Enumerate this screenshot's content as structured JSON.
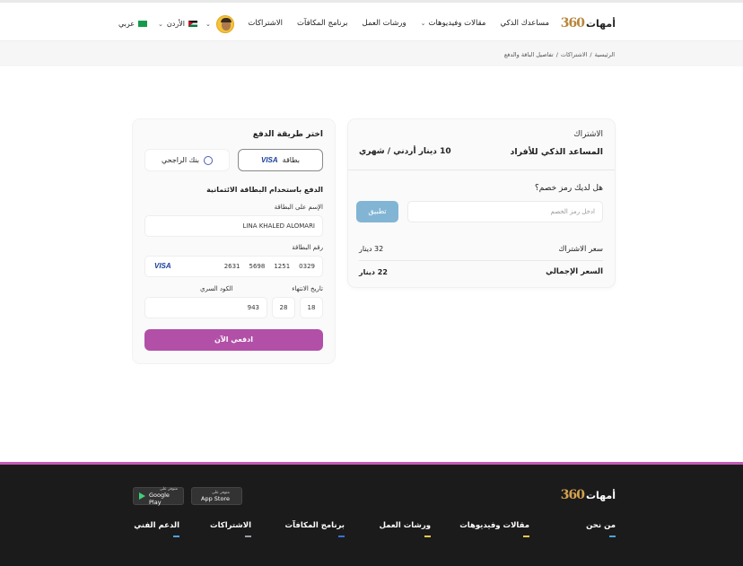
{
  "logo": {
    "text": "أمهات",
    "number": "360"
  },
  "nav": [
    {
      "label": "مساعدك الذكي",
      "has_dropdown": false
    },
    {
      "label": "مقالات وفيديوهات",
      "has_dropdown": true
    },
    {
      "label": "ورشات العمل",
      "has_dropdown": false
    },
    {
      "label": "برنامج المكافآت",
      "has_dropdown": false
    },
    {
      "label": "الاشتراكات",
      "has_dropdown": false
    }
  ],
  "country": {
    "label": "الأردن"
  },
  "language": {
    "label": "عربي"
  },
  "breadcrumb": [
    "الرئيسية",
    "/",
    "الاشتراكات",
    "/",
    "تفاصيل الباقة والدفع"
  ],
  "subscription": {
    "title": "الاشتراك",
    "plan_name": "المساعد الذكي للأفراد",
    "plan_price": "10 دينار أردني / شهري",
    "promo_question": "هل لديك رمز خصم؟",
    "promo_placeholder": "ادخل رمز الخصم",
    "apply_label": "تطبيق",
    "rows": [
      {
        "label": "سعر الاشتراك",
        "value": "32 دينار"
      },
      {
        "label": "السعر الإجمالي",
        "value": "22 دينار"
      }
    ]
  },
  "payment": {
    "title": "اختر طريقة الدفع",
    "methods": {
      "card_label": "بطاقة",
      "card_brand": "VISA",
      "bank_label": "بنك الراجحي"
    },
    "section_title": "الدفع باستخدام البطاقة الائتمانية",
    "name_label": "الإسم على البطاقة",
    "name_value": "LINA KHALED ALOMARI",
    "number_label": "رقم البطاقة",
    "number_groups": [
      "2631",
      "5698",
      "1251",
      "0329"
    ],
    "expiry_label": "تاريخ الانتهاء",
    "expiry_month": "18",
    "expiry_year": "28",
    "cvv_label": "الكود السري",
    "cvv_value": "943",
    "pay_label": "ادفعي الآن"
  },
  "footer": {
    "app_store": {
      "small": "متوفر على",
      "big": "App Store"
    },
    "google_play": {
      "small": "متوفر على",
      "big": "Google Play"
    },
    "columns": [
      {
        "title": "من نحن",
        "color": "#4aa3df"
      },
      {
        "title": "مقالات وفيديوهات",
        "color": "#f2c94c"
      },
      {
        "title": "ورشات العمل",
        "color": "#f2c94c"
      },
      {
        "title": "برنامج المكافآت",
        "color": "#3b6fd8"
      },
      {
        "title": "الاشتراكات",
        "color": "#9aa0a6"
      },
      {
        "title": "الدعم الفني",
        "color": "#4aa3df"
      }
    ]
  },
  "colors": {
    "accent": "#b250a8",
    "apply": "#82b5d4",
    "footer_bg": "#1b1b1b",
    "footer_line": "#c25ab9"
  }
}
